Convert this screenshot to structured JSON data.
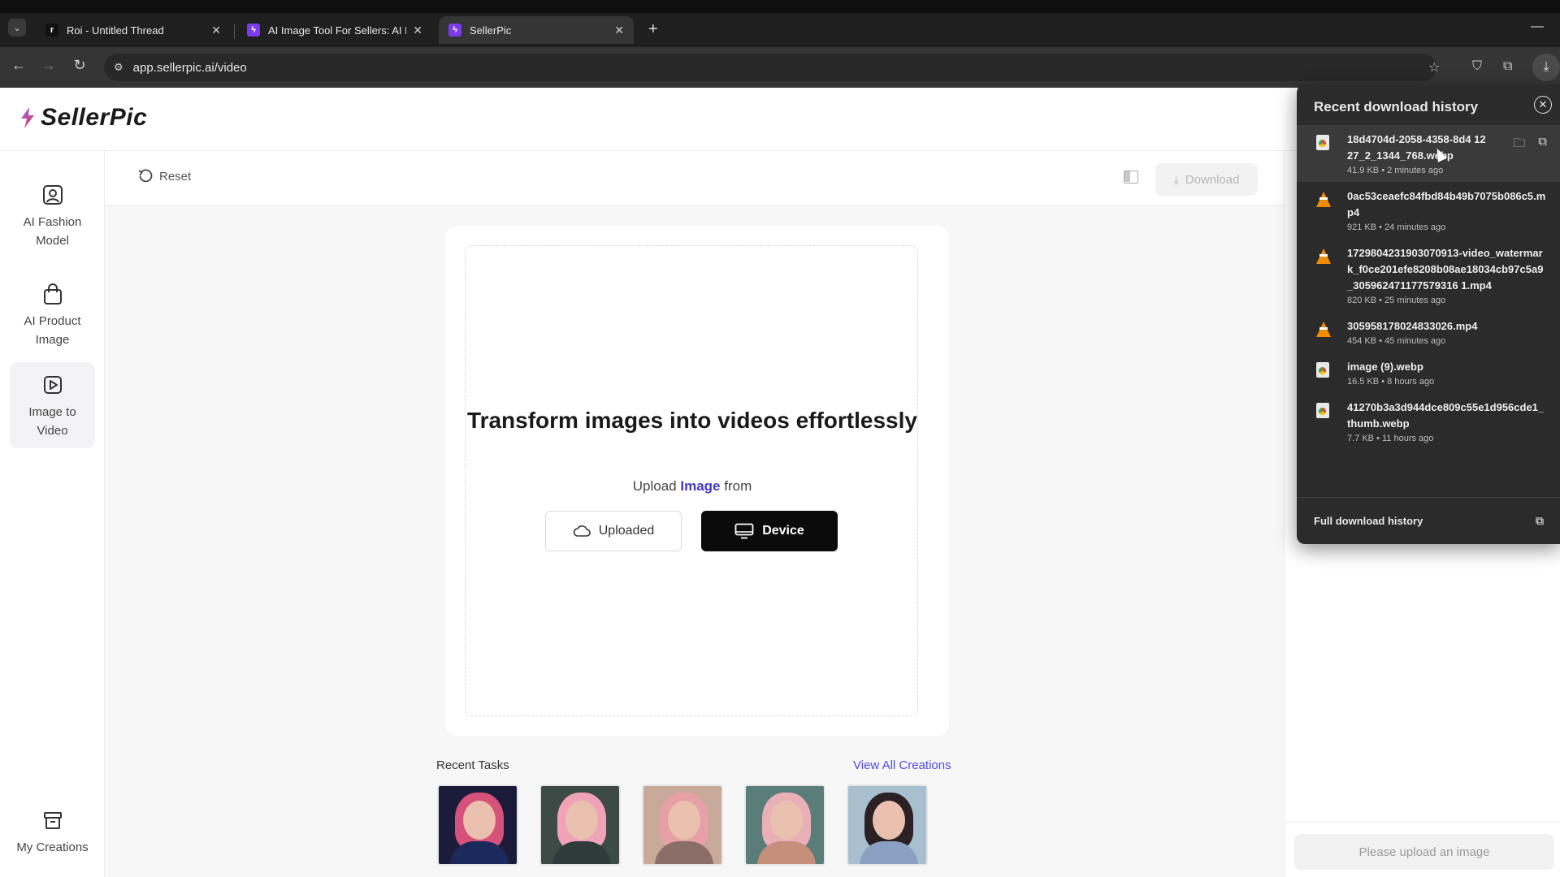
{
  "browser": {
    "tabs": [
      {
        "title": "Roi - Untitled Thread",
        "favicon_color": "#111111"
      },
      {
        "title": "AI Image Tool For Sellers: AI Fa",
        "favicon_color": "#7c3aed"
      },
      {
        "title": "SellerPic",
        "favicon_color": "#7c3aed",
        "active": true
      }
    ],
    "url": "app.sellerpic.ai/video"
  },
  "app": {
    "logo_text": "SellerPic",
    "brand_colors": {
      "accent": "#4f46e5",
      "logo_gradient": [
        "#8b5cf6",
        "#ef4444"
      ]
    },
    "sidebar": [
      {
        "label": "AI Fashion Model",
        "icon": "user-portrait-icon"
      },
      {
        "label": "AI Product Image",
        "icon": "shopping-bag-icon"
      },
      {
        "label": "Image to Video",
        "icon": "play-square-icon",
        "active": true
      },
      {
        "label": "My Creations",
        "icon": "archive-box-icon"
      }
    ],
    "toolbar": {
      "reset_label": "Reset",
      "download_label": "Download"
    },
    "hero": {
      "title": "Transform images into videos effortlessly",
      "subtitle_prefix": "Upload",
      "subtitle_highlight": "Image",
      "subtitle_suffix": "from"
    },
    "upload_buttons": {
      "uploaded_label": "Uploaded",
      "device_label": "Device"
    },
    "recent": {
      "label": "Recent Tasks",
      "view_all": "View All Creations",
      "thumbnails": [
        {
          "hair": "#d6527a",
          "body": "#1b2a5a",
          "bg": "#1c1c3a"
        },
        {
          "hair": "#f0a3b8",
          "body": "#2e3b3a",
          "bg": "#3d4a45"
        },
        {
          "hair": "#e7a0a6",
          "body": "#8a6d66",
          "bg": "#c9a99a"
        },
        {
          "hair": "#eab0b8",
          "body": "#c58f7c",
          "bg": "#5a7d7a"
        },
        {
          "hair": "#2b2024",
          "body": "#8aa1c4",
          "bg": "#a8bfcf"
        }
      ]
    },
    "right_panel": {
      "cta_label": "Please upload an image"
    }
  },
  "downloads": {
    "title": "Recent download history",
    "items": [
      {
        "name": "18d4704d-2058-4358-8d4 1227_2_1344_768.webp",
        "size": "41.9 KB",
        "time": "2 minutes ago",
        "icon": "image-file-icon"
      },
      {
        "name": "0ac53ceaefc84fbd84b49b7075b086c5.mp4",
        "size": "921 KB",
        "time": "24 minutes ago",
        "icon": "vlc-cone-icon"
      },
      {
        "name": "1729804231903070913-video_watermark_f0ce201efe8208b08ae18034cb97c5a9_305962471177579316 1.mp4",
        "size": "820 KB",
        "time": "25 minutes ago",
        "icon": "vlc-cone-icon"
      },
      {
        "name": "305958178024833026.mp4",
        "size": "454 KB",
        "time": "45 minutes ago",
        "icon": "vlc-cone-icon"
      },
      {
        "name": "image (9).webp",
        "size": "16.5 KB",
        "time": "8 hours ago",
        "icon": "image-file-icon"
      },
      {
        "name": "41270b3a3d944dce809c55e1d956cde1_thumb.webp",
        "size": "7.7 KB",
        "time": "11 hours ago",
        "icon": "image-file-icon"
      }
    ],
    "footer_label": "Full download history"
  }
}
